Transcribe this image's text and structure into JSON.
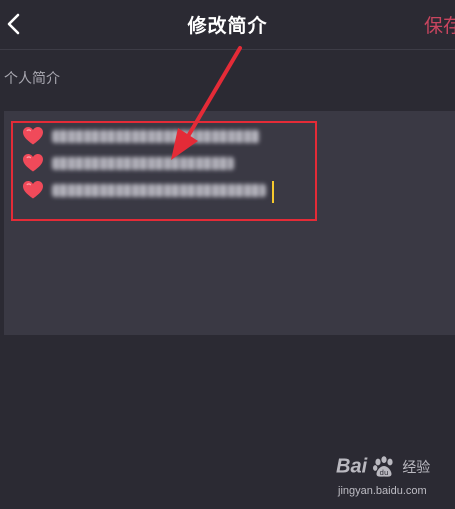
{
  "header": {
    "title": "修改简介",
    "save_label": "保存"
  },
  "section": {
    "label": "个人简介"
  },
  "bio": {
    "lines": [
      {
        "icon": "heart-icon",
        "text": ""
      },
      {
        "icon": "heart-icon",
        "text": ""
      },
      {
        "icon": "heart-icon",
        "text": ""
      }
    ],
    "note": "bio text is pixel-blurred in the screenshot"
  },
  "colors": {
    "background": "#2b2a33",
    "textarea": "#3a3944",
    "save_accent": "#c9455f",
    "annotation_red": "#e42b37",
    "cursor": "#f6c92e",
    "heart": "#f04a5a"
  },
  "watermark": {
    "brand_prefix": "Bai",
    "brand_suffix": "经验",
    "url": "jingyan.baidu.com"
  }
}
